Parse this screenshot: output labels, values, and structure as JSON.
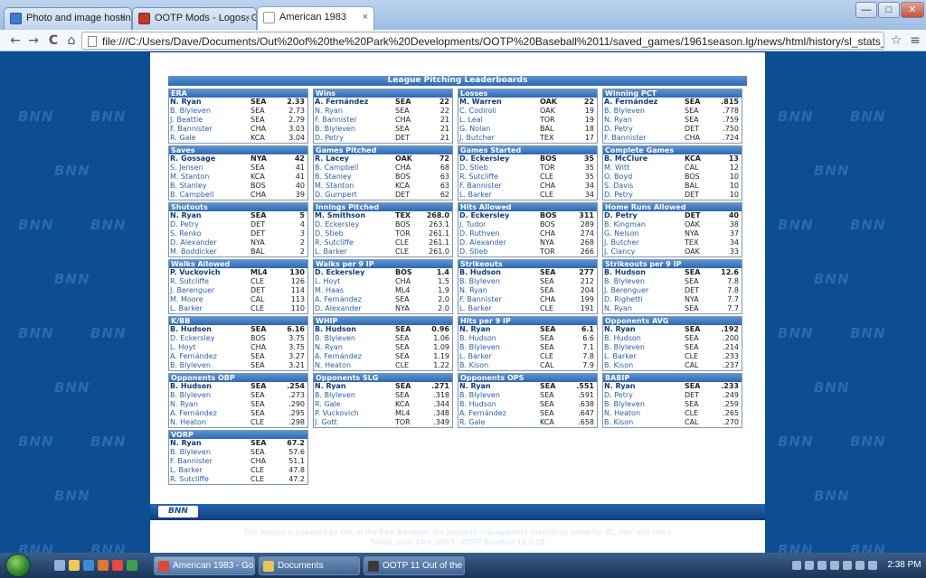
{
  "tabs": [
    {
      "label": "Photo and image hosting,",
      "close": "×"
    },
    {
      "label": "OOTP Mods - Logos, Grap",
      "close": "×"
    },
    {
      "label": "American 1983",
      "close": "×"
    }
  ],
  "window_controls": {
    "minimize": "—",
    "maximize": "□",
    "close": "✕"
  },
  "toolbar": {
    "back": "←",
    "forward": "→",
    "reload": "C",
    "home": "⌂",
    "url": "file:///C:/Users/Dave/Documents/Out%20of%20the%20Park%20Developments/OOTP%20Baseball%2011/saved_games/1961season.lg/news/html/history/sl_stats_100_0_1983.html",
    "star": "☆",
    "menu": "≡"
  },
  "watermark": "BNN",
  "section_title": "League Pitching Leaderboards",
  "boards": [
    {
      "title": "ERA",
      "rows": [
        [
          "N. Ryan",
          "SEA",
          "2.33"
        ],
        [
          "B. Blyleven",
          "SEA",
          "2.73"
        ],
        [
          "J. Beattie",
          "SEA",
          "2.79"
        ],
        [
          "F. Bannister",
          "CHA",
          "3.03"
        ],
        [
          "R. Gale",
          "KCA",
          "3.04"
        ]
      ]
    },
    {
      "title": "Wins",
      "rows": [
        [
          "A. Fernández",
          "SEA",
          "22"
        ],
        [
          "N. Ryan",
          "SEA",
          "22"
        ],
        [
          "F. Bannister",
          "CHA",
          "21"
        ],
        [
          "B. Blyleven",
          "SEA",
          "21"
        ],
        [
          "D. Petry",
          "DET",
          "21"
        ]
      ]
    },
    {
      "title": "Losses",
      "rows": [
        [
          "M. Warren",
          "OAK",
          "22"
        ],
        [
          "C. Codiroli",
          "OAK",
          "19"
        ],
        [
          "L. Leal",
          "TOR",
          "19"
        ],
        [
          "G. Nolan",
          "BAL",
          "18"
        ],
        [
          "J. Butcher",
          "TEX",
          "17"
        ]
      ]
    },
    {
      "title": "Winning PCT",
      "rows": [
        [
          "A. Fernández",
          "SEA",
          ".815"
        ],
        [
          "B. Blyleven",
          "SEA",
          ".778"
        ],
        [
          "N. Ryan",
          "SEA",
          ".759"
        ],
        [
          "D. Petry",
          "DET",
          ".750"
        ],
        [
          "F. Bannister",
          "CHA",
          ".724"
        ]
      ]
    },
    {
      "title": "Saves",
      "rows": [
        [
          "R. Gossage",
          "NYA",
          "42"
        ],
        [
          "S. Jensen",
          "SEA",
          "41"
        ],
        [
          "M. Stanton",
          "KCA",
          "41"
        ],
        [
          "B. Stanley",
          "BOS",
          "40"
        ],
        [
          "B. Campbell",
          "CHA",
          "39"
        ]
      ]
    },
    {
      "title": "Games Pitched",
      "rows": [
        [
          "R. Lacey",
          "OAK",
          "72"
        ],
        [
          "B. Campbell",
          "CHA",
          "68"
        ],
        [
          "B. Stanley",
          "BOS",
          "63"
        ],
        [
          "M. Stanton",
          "KCA",
          "63"
        ],
        [
          "D. Gumpert",
          "DET",
          "62"
        ]
      ]
    },
    {
      "title": "Games Started",
      "rows": [
        [
          "D. Eckersley",
          "BOS",
          "35"
        ],
        [
          "D. Stieb",
          "TOR",
          "35"
        ],
        [
          "R. Sutcliffe",
          "CLE",
          "35"
        ],
        [
          "F. Bannister",
          "CHA",
          "34"
        ],
        [
          "L. Barker",
          "CLE",
          "34"
        ]
      ]
    },
    {
      "title": "Complete Games",
      "rows": [
        [
          "B. McClure",
          "KCA",
          "13"
        ],
        [
          "M. Witt",
          "CAL",
          "12"
        ],
        [
          "O. Boyd",
          "BOS",
          "10"
        ],
        [
          "S. Davis",
          "BAL",
          "10"
        ],
        [
          "D. Petry",
          "DET",
          "10"
        ]
      ]
    },
    {
      "title": "Shutouts",
      "rows": [
        [
          "N. Ryan",
          "SEA",
          "5"
        ],
        [
          "D. Petry",
          "DET",
          "4"
        ],
        [
          "S. Renko",
          "DET",
          "3"
        ],
        [
          "D. Alexander",
          "NYA",
          "2"
        ],
        [
          "M. Boddicker",
          "BAL",
          "2"
        ]
      ]
    },
    {
      "title": "Innings Pitched",
      "rows": [
        [
          "M. Smithson",
          "TEX",
          "268.0"
        ],
        [
          "D. Eckersley",
          "BOS",
          "263.1"
        ],
        [
          "D. Stieb",
          "TOR",
          "261.1"
        ],
        [
          "R. Sutcliffe",
          "CLE",
          "261.1"
        ],
        [
          "L. Barker",
          "CLE",
          "261.0"
        ]
      ]
    },
    {
      "title": "Hits Allowed",
      "rows": [
        [
          "D. Eckersley",
          "BOS",
          "311"
        ],
        [
          "J. Tudor",
          "BOS",
          "289"
        ],
        [
          "D. Ruthven",
          "CHA",
          "274"
        ],
        [
          "D. Alexander",
          "NYA",
          "268"
        ],
        [
          "D. Stieb",
          "TOR",
          "266"
        ]
      ]
    },
    {
      "title": "Home Runs Allowed",
      "rows": [
        [
          "D. Petry",
          "DET",
          "40"
        ],
        [
          "B. Kingman",
          "OAK",
          "38"
        ],
        [
          "G. Nelson",
          "NYA",
          "37"
        ],
        [
          "J. Butcher",
          "TEX",
          "34"
        ],
        [
          "J. Clancy",
          "OAK",
          "33"
        ]
      ]
    },
    {
      "title": "Walks Allowed",
      "rows": [
        [
          "P. Vuckovich",
          "ML4",
          "130"
        ],
        [
          "R. Sutcliffe",
          "CLE",
          "126"
        ],
        [
          "J. Berenguer",
          "DET",
          "114"
        ],
        [
          "M. Moore",
          "CAL",
          "113"
        ],
        [
          "L. Barker",
          "CLE",
          "110"
        ]
      ]
    },
    {
      "title": "Walks per 9 IP",
      "rows": [
        [
          "D. Eckersley",
          "BOS",
          "1.4"
        ],
        [
          "L. Hoyt",
          "CHA",
          "1.5"
        ],
        [
          "M. Haas",
          "ML4",
          "1.9"
        ],
        [
          "A. Fernández",
          "SEA",
          "2.0"
        ],
        [
          "D. Alexander",
          "NYA",
          "2.0"
        ]
      ]
    },
    {
      "title": "Strikeouts",
      "rows": [
        [
          "B. Hudson",
          "SEA",
          "277"
        ],
        [
          "B. Blyleven",
          "SEA",
          "212"
        ],
        [
          "N. Ryan",
          "SEA",
          "204"
        ],
        [
          "F. Bannister",
          "CHA",
          "199"
        ],
        [
          "L. Barker",
          "CLE",
          "191"
        ]
      ]
    },
    {
      "title": "Strikeouts per 9 IP",
      "rows": [
        [
          "B. Hudson",
          "SEA",
          "12.6"
        ],
        [
          "B. Blyleven",
          "SEA",
          "7.8"
        ],
        [
          "J. Berenguer",
          "DET",
          "7.8"
        ],
        [
          "D. Righetti",
          "NYA",
          "7.7"
        ],
        [
          "N. Ryan",
          "SEA",
          "7.7"
        ]
      ]
    },
    {
      "title": "K/BB",
      "rows": [
        [
          "B. Hudson",
          "SEA",
          "6.16"
        ],
        [
          "D. Eckersley",
          "BOS",
          "3.75"
        ],
        [
          "L. Hoyt",
          "CHA",
          "3.75"
        ],
        [
          "A. Fernández",
          "SEA",
          "3.27"
        ],
        [
          "B. Blyleven",
          "SEA",
          "3.21"
        ]
      ]
    },
    {
      "title": "WHIP",
      "rows": [
        [
          "B. Hudson",
          "SEA",
          "0.96"
        ],
        [
          "B. Blyleven",
          "SEA",
          "1.06"
        ],
        [
          "N. Ryan",
          "SEA",
          "1.09"
        ],
        [
          "A. Fernández",
          "SEA",
          "1.19"
        ],
        [
          "N. Heaton",
          "CLE",
          "1.22"
        ]
      ]
    },
    {
      "title": "Hits per 9 IP",
      "rows": [
        [
          "N. Ryan",
          "SEA",
          "6.1"
        ],
        [
          "B. Hudson",
          "SEA",
          "6.6"
        ],
        [
          "B. Blyleven",
          "SEA",
          "7.1"
        ],
        [
          "L. Barker",
          "CLE",
          "7.8"
        ],
        [
          "B. Kison",
          "CAL",
          "7.9"
        ]
      ]
    },
    {
      "title": "Opponents AVG",
      "rows": [
        [
          "N. Ryan",
          "SEA",
          ".192"
        ],
        [
          "B. Hudson",
          "SEA",
          ".200"
        ],
        [
          "B. Blyleven",
          "SEA",
          ".214"
        ],
        [
          "L. Barker",
          "CLE",
          ".233"
        ],
        [
          "B. Kison",
          "CAL",
          ".237"
        ]
      ]
    },
    {
      "title": "Opponents OBP",
      "rows": [
        [
          "B. Hudson",
          "SEA",
          ".254"
        ],
        [
          "B. Blyleven",
          "SEA",
          ".273"
        ],
        [
          "N. Ryan",
          "SEA",
          ".290"
        ],
        [
          "A. Fernández",
          "SEA",
          ".295"
        ],
        [
          "N. Heaton",
          "CLE",
          ".298"
        ]
      ]
    },
    {
      "title": "Opponents SLG",
      "rows": [
        [
          "N. Ryan",
          "SEA",
          ".271"
        ],
        [
          "B. Blyleven",
          "SEA",
          ".318"
        ],
        [
          "R. Gale",
          "KCA",
          ".344"
        ],
        [
          "P. Vuckovich",
          "ML4",
          ".348"
        ],
        [
          "J. Gott",
          "TOR",
          ".349"
        ]
      ]
    },
    {
      "title": "Opponents OPS",
      "rows": [
        [
          "N. Ryan",
          "SEA",
          ".551"
        ],
        [
          "B. Blyleven",
          "SEA",
          ".591"
        ],
        [
          "B. Hudson",
          "SEA",
          ".638"
        ],
        [
          "A. Fernández",
          "SEA",
          ".647"
        ],
        [
          "R. Gale",
          "KCA",
          ".658"
        ]
      ]
    },
    {
      "title": "BABIP",
      "rows": [
        [
          "N. Ryan",
          "SEA",
          ".233"
        ],
        [
          "D. Petry",
          "DET",
          ".249"
        ],
        [
          "B. Blyleven",
          "SEA",
          ".259"
        ],
        [
          "N. Heaton",
          "CLE",
          ".265"
        ],
        [
          "B. Kison",
          "CAL",
          ".270"
        ]
      ]
    },
    {
      "title": "VORP",
      "rows": [
        [
          "N. Ryan",
          "SEA",
          "67.2"
        ],
        [
          "B. Blyleven",
          "SEA",
          "57.6"
        ],
        [
          "F. Bannister",
          "CHA",
          "51.1"
        ],
        [
          "L. Barker",
          "CLE",
          "47.8"
        ],
        [
          "R. Sutcliffe",
          "CLE",
          "47.2"
        ]
      ]
    }
  ],
  "footer": {
    "logo": "BNN",
    "line1": "This league is powered by Out of the Park Baseball, the baseball management simulation game for PC, Mac and Linux",
    "line2": "Friday, June 14th, 2013 - OOTP Baseball 11.2.28"
  },
  "taskbar": {
    "items": [
      {
        "label": "American 1983 - Go...",
        "icon_color": "#d84a38"
      },
      {
        "label": "Documents",
        "icon_color": "#e8c35a"
      },
      {
        "label": "OOTP 11 Out of the ...",
        "icon_color": "#3a3a3a"
      }
    ],
    "clock": "2:38 PM"
  },
  "colors": {
    "accent": "#2d69b3",
    "background": "#0b4a8c",
    "link": "#2a5fa8",
    "leader": "#113a78"
  }
}
